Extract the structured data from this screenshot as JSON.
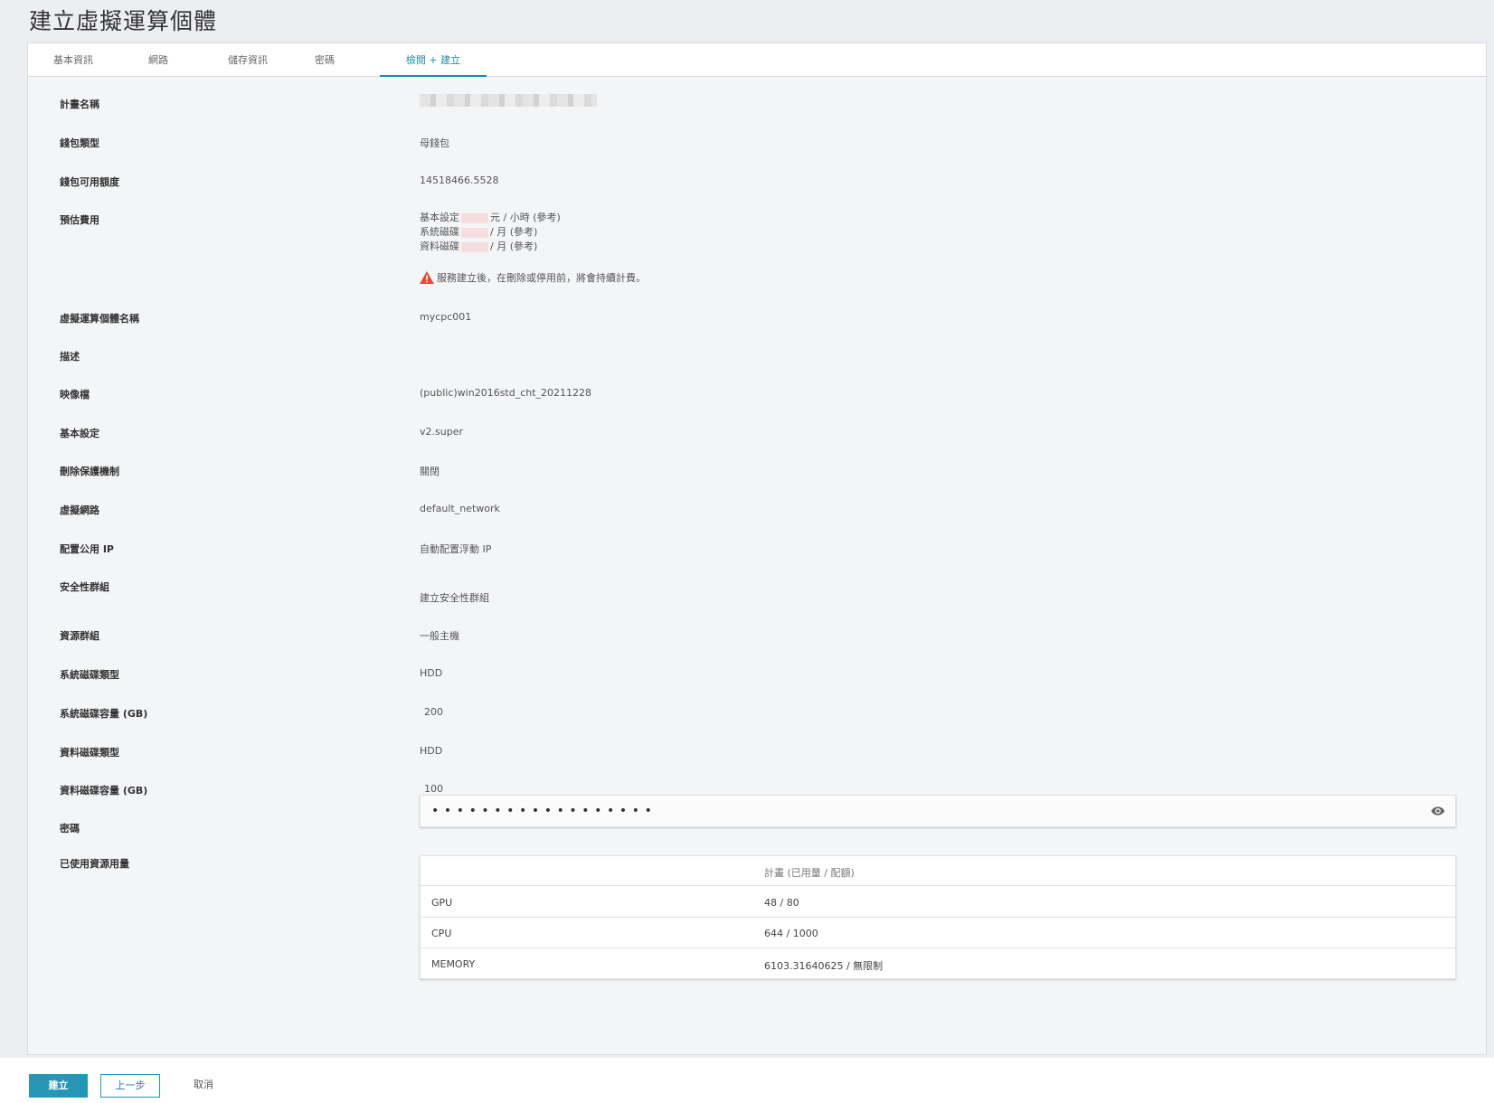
{
  "page_title": "建立虛擬運算個體",
  "tabs": [
    {
      "label": "基本資訊"
    },
    {
      "label": "網路"
    },
    {
      "label": "儲存資訊"
    },
    {
      "label": "密碼"
    },
    {
      "label": "檢閱 + 建立",
      "active": true
    }
  ],
  "fields": {
    "project_name": {
      "label": "計畫名稱",
      "value": ""
    },
    "wallet_type": {
      "label": "錢包類型",
      "value": "母錢包"
    },
    "wallet_balance": {
      "label": "錢包可用額度",
      "value": "14518466.5528"
    },
    "estimated_cost": {
      "label": "預估費用",
      "base_prefix": "基本設定",
      "base_suffix": "元 / 小時 (參考)",
      "sys_prefix": "系統磁碟",
      "sys_suffix": "/ 月 (參考)",
      "data_prefix": "資料磁碟",
      "data_suffix": "/ 月 (參考)",
      "warning": "服務建立後，在刪除或停用前，將會持續計費。"
    },
    "instance_name": {
      "label": "虛擬運算個體名稱",
      "value": "mycpc001"
    },
    "description": {
      "label": "描述",
      "value": ""
    },
    "image": {
      "label": "映像檔",
      "value": "(public)win2016std_cht_20211228"
    },
    "flavor": {
      "label": "基本設定",
      "value": "v2.super"
    },
    "delete_protection": {
      "label": "刪除保護機制",
      "value": "關閉"
    },
    "virtual_network": {
      "label": "虛擬網路",
      "value": "default_network"
    },
    "public_ip": {
      "label": "配置公用 IP",
      "value": "自動配置浮動 IP"
    },
    "security_group": {
      "label": "安全性群組",
      "value": "建立安全性群組"
    },
    "resource_group": {
      "label": "資源群組",
      "value": "一般主機"
    },
    "sys_disk_type": {
      "label": "系統磁碟類型",
      "value": "HDD"
    },
    "sys_disk_size": {
      "label": "系統磁碟容量 (GB)",
      "value": "200"
    },
    "data_disk_type": {
      "label": "資料磁碟類型",
      "value": "HDD"
    },
    "data_disk_size": {
      "label": "資料磁碟容量 (GB)",
      "value": "100"
    },
    "password": {
      "label": "密碼",
      "masked": "••••••••••••••••••"
    },
    "usage": {
      "label": "已使用資源用量",
      "column": "計畫 (已用量 / 配額)",
      "rows": [
        {
          "name": "GPU",
          "value": "48 / 80"
        },
        {
          "name": "CPU",
          "value": "644 / 1000"
        },
        {
          "name": "MEMORY",
          "value": "6103.31640625 / 無限制"
        }
      ]
    }
  },
  "footer": {
    "create": "建立",
    "prev": "上一步",
    "cancel": "取消"
  },
  "colors": {
    "accent": "#2597b5",
    "warning": "#e24c3a"
  },
  "icons": {
    "warning": "warning-triangle-icon",
    "password_toggle": "eye-icon"
  }
}
